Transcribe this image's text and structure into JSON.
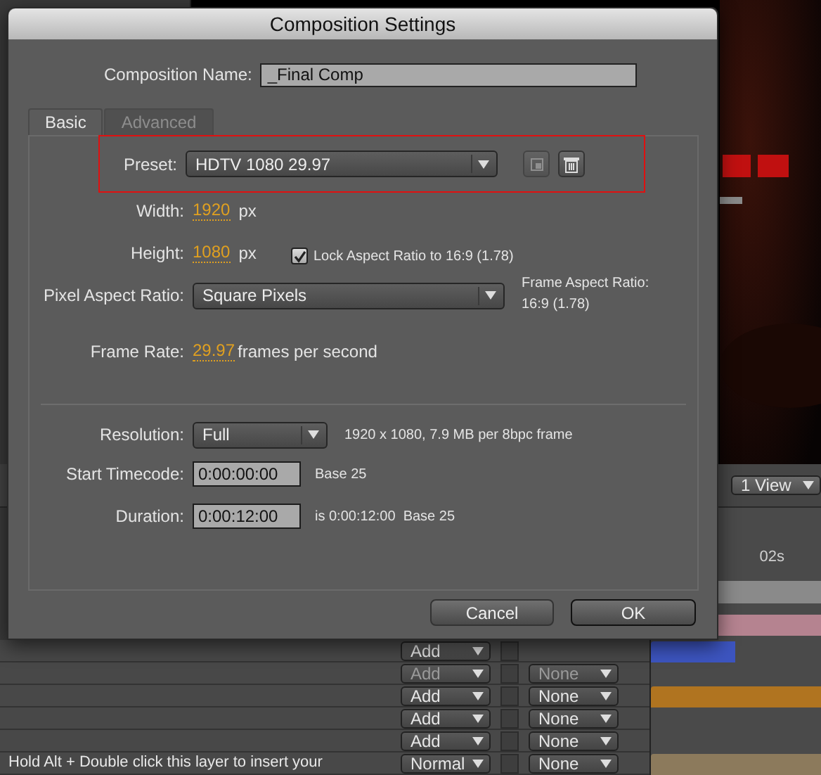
{
  "background": {
    "view_menu": "1 View",
    "time_marker": "02s",
    "hint": "Hold Alt + Double click this layer to insert your",
    "layers": [
      {
        "mode": "Add",
        "color": "#3d55c0"
      },
      {
        "mode": "Add",
        "track": "None"
      },
      {
        "mode": "Add",
        "track": "None",
        "color": "#b07420"
      },
      {
        "mode": "Add",
        "track": "None"
      },
      {
        "mode": "Add",
        "track": "None"
      },
      {
        "mode": "Normal",
        "track": "None",
        "color": "#8c7a5c"
      }
    ]
  },
  "dialog": {
    "title": "Composition Settings",
    "name": {
      "label": "Composition Name:",
      "value": "_Final Comp"
    },
    "tabs": [
      {
        "label": "Basic",
        "selected": true
      },
      {
        "label": "Advanced",
        "selected": false
      }
    ],
    "preset": {
      "label": "Preset:",
      "value": "HDTV 1080 29.97"
    },
    "width": {
      "label": "Width:",
      "value": "1920",
      "unit": "px"
    },
    "height": {
      "label": "Height:",
      "value": "1080",
      "unit": "px"
    },
    "lock": {
      "label": "Lock Aspect Ratio to 16:9 (1.78)",
      "checked": true
    },
    "pixel_aspect": {
      "label": "Pixel Aspect Ratio:",
      "value": "Square Pixels",
      "frame_label": "Frame Aspect Ratio:",
      "frame_value": "16:9 (1.78)"
    },
    "frame_rate": {
      "label": "Frame Rate:",
      "value": "29.97",
      "unit": "frames per second"
    },
    "resolution": {
      "label": "Resolution:",
      "value": "Full",
      "info": "1920 x 1080, 7.9 MB per 8bpc frame"
    },
    "start": {
      "label": "Start Timecode:",
      "value": "0:00:00:00",
      "info": "Base 25"
    },
    "duration": {
      "label": "Duration:",
      "value": "0:00:12:00",
      "info": "is 0:00:12:00  Base 25"
    },
    "buttons": [
      {
        "label": "Cancel",
        "default": false
      },
      {
        "label": "OK",
        "default": true
      }
    ]
  }
}
